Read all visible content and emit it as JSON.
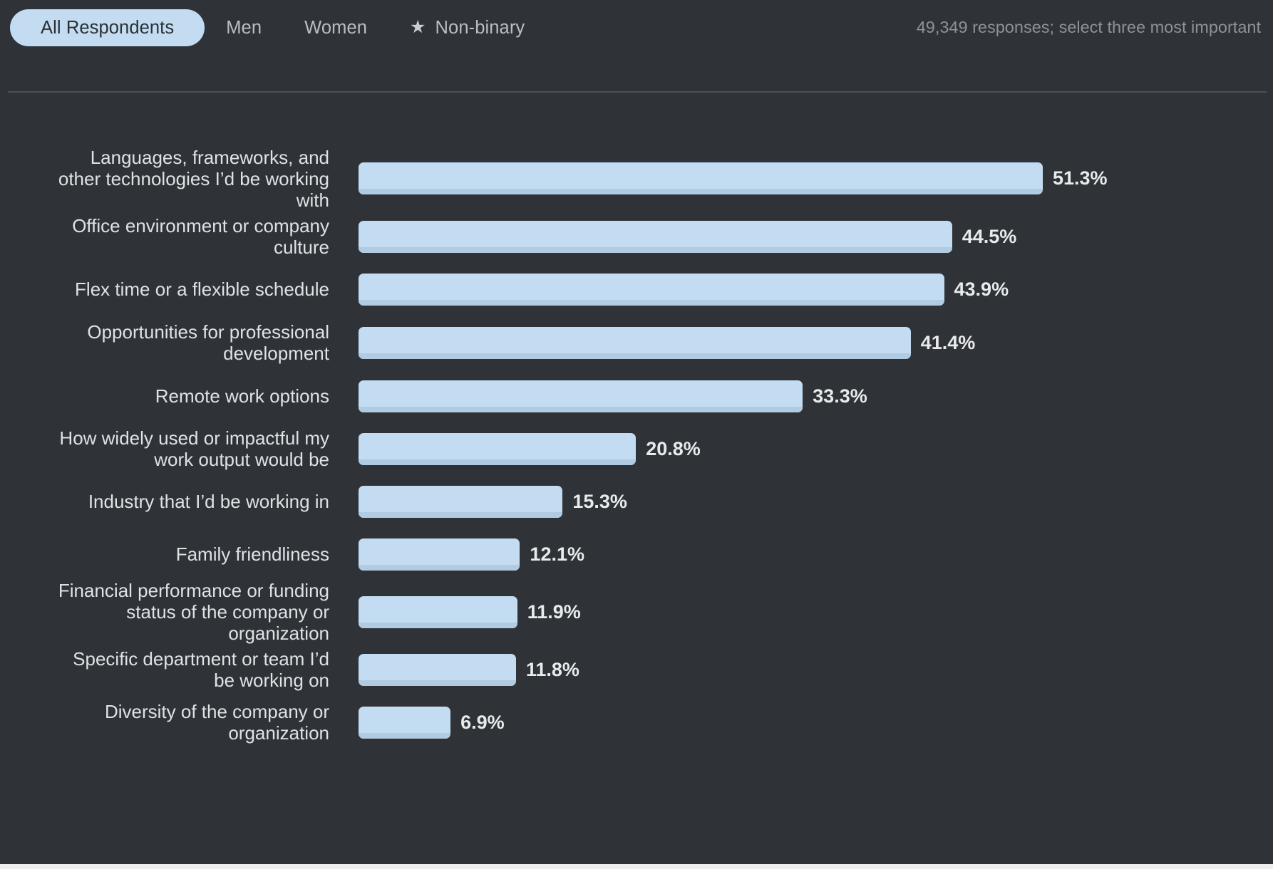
{
  "header": {
    "tabs": [
      {
        "label": "All Respondents",
        "active": true,
        "icon": null
      },
      {
        "label": "Men",
        "active": false,
        "icon": null
      },
      {
        "label": "Women",
        "active": false,
        "icon": null
      },
      {
        "label": "Non-binary",
        "active": false,
        "icon": "star-icon"
      }
    ],
    "responses_note": "49,349 responses; select three most important"
  },
  "colors": {
    "background": "#2f3338",
    "bar_fill": "#c3dcf1",
    "bar_shadow": "#b1cbe2",
    "active_tab_bg": "#c3dcf1",
    "label_text": "#dfe2e5",
    "muted_text": "#8d9299",
    "divider": "#4b5158"
  },
  "chart_data": {
    "type": "bar",
    "orientation": "horizontal",
    "title": "",
    "subtitle": "",
    "xlabel": "",
    "ylabel": "",
    "grid": false,
    "legend": "none",
    "xlim": [
      0,
      51.3
    ],
    "value_suffix": "%",
    "categories": [
      "Languages, frameworks, and\nother technologies I’d be working\nwith",
      "Office environment or company\nculture",
      "Flex time or a flexible schedule",
      "Opportunities for professional\ndevelopment",
      "Remote work options",
      "How widely used or impactful my\nwork output would be",
      "Industry that I’d be working in",
      "Family friendliness",
      "Financial performance or funding\nstatus of the company or\norganization",
      "Specific department or team I’d\nbe working on",
      "Diversity of the company or\norganization"
    ],
    "values": [
      51.3,
      44.5,
      43.9,
      41.4,
      33.3,
      20.8,
      15.3,
      12.1,
      11.9,
      11.8,
      6.9
    ],
    "value_labels": [
      "51.3%",
      "44.5%",
      "43.9%",
      "41.4%",
      "33.3%",
      "20.8%",
      "15.3%",
      "12.1%",
      "11.9%",
      "11.8%",
      "6.9%"
    ]
  }
}
